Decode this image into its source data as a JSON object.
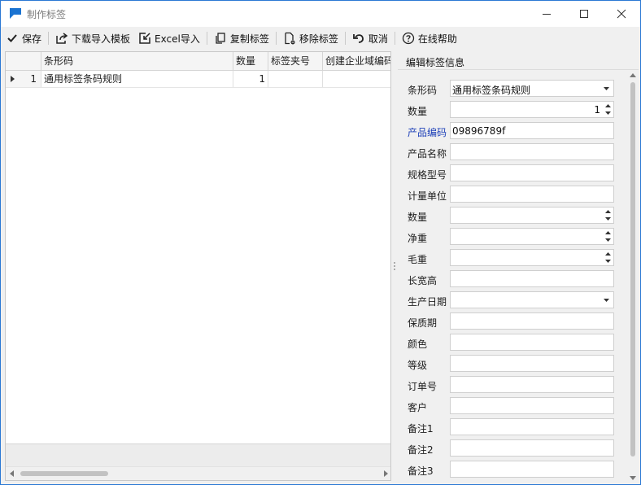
{
  "window": {
    "title": "制作标签",
    "accent": "#2b78d4"
  },
  "toolbar": {
    "save": {
      "label": "保存",
      "icon": "checkmark-icon"
    },
    "download_template": {
      "label": "下载导入模板",
      "icon": "export-icon"
    },
    "excel_import": {
      "label": "Excel导入",
      "icon": "import-icon"
    },
    "copy_label": {
      "label": "复制标签",
      "icon": "copy-icon"
    },
    "remove_label": {
      "label": "移除标签",
      "icon": "remove-doc-icon"
    },
    "cancel": {
      "label": "取消",
      "icon": "undo-icon"
    },
    "help": {
      "label": "在线帮助",
      "icon": "help-icon"
    }
  },
  "grid": {
    "columns": [
      "条形码",
      "数量",
      "标签夹号",
      "创建企业域编码"
    ],
    "rows": [
      {
        "index": "1",
        "barcode_rule": "通用标签条码规则",
        "quantity": "1",
        "folder_no": "",
        "domain_code": ""
      }
    ]
  },
  "panel": {
    "title": "编辑标签信息",
    "fields": [
      {
        "label": "条形码",
        "value": "通用标签条码规则",
        "type": "dropdown"
      },
      {
        "label": "数量",
        "value": "1",
        "type": "spinner"
      },
      {
        "label": "产品编码",
        "value": "09896789f",
        "type": "link-text"
      },
      {
        "label": "产品名称",
        "value": "",
        "type": "text"
      },
      {
        "label": "规格型号",
        "value": "",
        "type": "text"
      },
      {
        "label": "计量单位",
        "value": "",
        "type": "text"
      },
      {
        "label": "数量",
        "value": "",
        "type": "spinner"
      },
      {
        "label": "净重",
        "value": "",
        "type": "spinner"
      },
      {
        "label": "毛重",
        "value": "",
        "type": "spinner"
      },
      {
        "label": "长宽高",
        "value": "",
        "type": "text"
      },
      {
        "label": "生产日期",
        "value": "",
        "type": "dropdown"
      },
      {
        "label": "保质期",
        "value": "",
        "type": "text"
      },
      {
        "label": "颜色",
        "value": "",
        "type": "text"
      },
      {
        "label": "等级",
        "value": "",
        "type": "text"
      },
      {
        "label": "订单号",
        "value": "",
        "type": "text"
      },
      {
        "label": "客户",
        "value": "",
        "type": "text"
      },
      {
        "label": "备注1",
        "value": "",
        "type": "text"
      },
      {
        "label": "备注2",
        "value": "",
        "type": "text"
      },
      {
        "label": "备注3",
        "value": "",
        "type": "text"
      }
    ]
  }
}
